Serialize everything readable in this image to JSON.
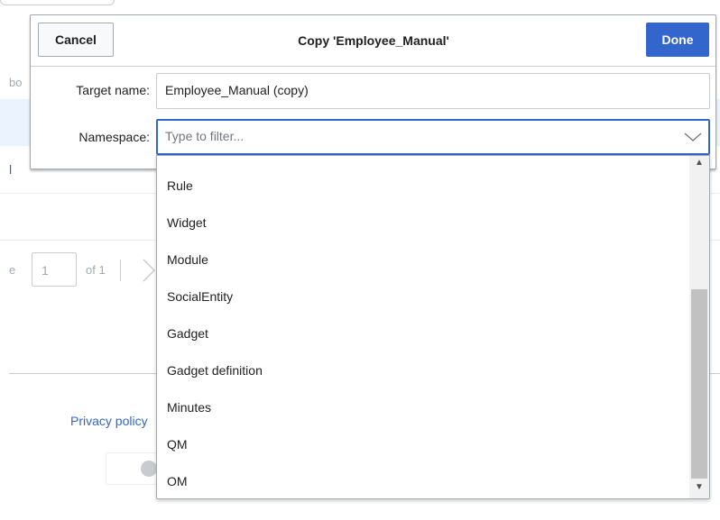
{
  "background": {
    "row1_text": "bo",
    "row3_link": "l",
    "pager": {
      "prefix": "e",
      "page_value": "1",
      "of_label": "of 1"
    },
    "footer": {
      "privacy_link": "Privacy policy"
    }
  },
  "dialog": {
    "title": "Copy 'Employee_Manual'",
    "cancel_label": "Cancel",
    "done_label": "Done",
    "target_label": "Target name:",
    "target_value": "Employee_Manual (copy)",
    "namespace_label": "Namespace:",
    "namespace_placeholder": "Type to filter..."
  },
  "dropdown": {
    "options": [
      "Rule",
      "Widget",
      "Module",
      "SocialEntity",
      "Gadget",
      "Gadget definition",
      "Minutes",
      "QM",
      "OM"
    ]
  },
  "colors": {
    "accent": "#3366cc",
    "border": "#a2a9b1"
  },
  "icons": {
    "namespace_toggle": "chevron-down-icon",
    "scroll_up": "arrow-up-icon",
    "scroll_down": "arrow-down-icon",
    "pager_next": "chevron-right-icon"
  }
}
